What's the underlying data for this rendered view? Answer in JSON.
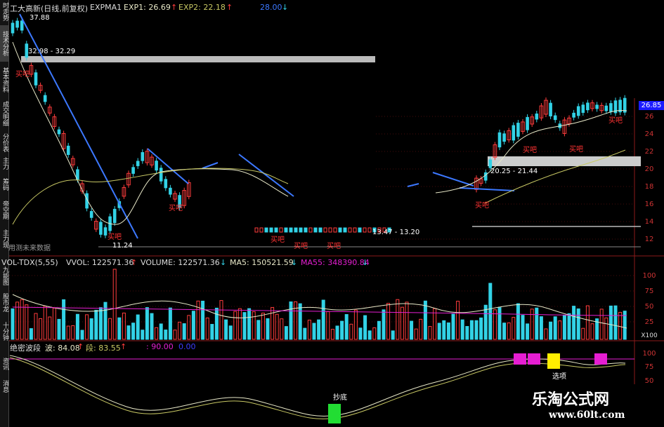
{
  "sidebar": {
    "tabs": [
      {
        "label": "时走势",
        "active": false
      },
      {
        "label": "技术分析",
        "active": true
      },
      {
        "label": "基本资料",
        "active": false
      },
      {
        "label": "成交明细",
        "active": false
      },
      {
        "label": "分价表",
        "active": false
      },
      {
        "label": "主力",
        "active": false
      },
      {
        "label": "筹码",
        "active": false
      },
      {
        "label": "帝空期",
        "active": false
      },
      {
        "label": "主力现",
        "active": false
      },
      {
        "label": "九能图",
        "active": false
      },
      {
        "label": "股市龙",
        "active": false
      },
      {
        "label": "十分钟",
        "active": false
      },
      {
        "label": "资讯",
        "active": false
      },
      {
        "label": "消息",
        "active": false
      }
    ]
  },
  "price_header": {
    "title": "工大高新(日线,前复权)",
    "indicator": "EXPMA1",
    "exp1": "EXP1: 26.69",
    "exp2": "EXP2: 22.18",
    "extra": "28.00",
    "up_arrow": "↑",
    "down_arrow": "↓"
  },
  "vol_header": {
    "name": "VOL-TDX(5,55)",
    "vvol": "VVOL: 122571.36",
    "volume": "VOLUME: 122571.36",
    "ma5": "MA5: 150521.59",
    "ma55": "MA55: 348390.84",
    "up_arrow": "↑",
    "down_arrow": "↓"
  },
  "osc_header": {
    "name": "绝密波段",
    "bo": "波: 84.08",
    "duan": "段: 83.55",
    "level": ": 90.00",
    "level2": "0.00",
    "up_arrow": "↑"
  },
  "price_axis": [
    "26",
    "24",
    "22",
    "20",
    "18",
    "16",
    "14",
    "12"
  ],
  "current_price": "26.85",
  "vol_axis": [
    "100",
    "75",
    "50",
    "25"
  ],
  "vol_unit": "X100",
  "osc_axis": [
    "100",
    "75",
    "50"
  ],
  "labels": {
    "high": "37.88",
    "range1": "32.98 - 32.29",
    "range2": "20.25 - 21.44",
    "range3": "13.47 - 13.20",
    "low": "11.24",
    "predict": "用测未来数据",
    "buy": "买吧",
    "bottom": "抄底",
    "pick": "选项"
  },
  "colors": {
    "up": "#ff3c3c",
    "down": "#32d2e6",
    "trend": "#3c78ff",
    "exp1": "#e8e8c8",
    "exp2": "#c8c864",
    "grid": "#8b1a1a",
    "magenta": "#e61ed2",
    "yellow": "#ffee00",
    "green": "#22dd33"
  },
  "watermark": {
    "title": "乐淘公式网",
    "url": "www.60lt.com"
  }
}
